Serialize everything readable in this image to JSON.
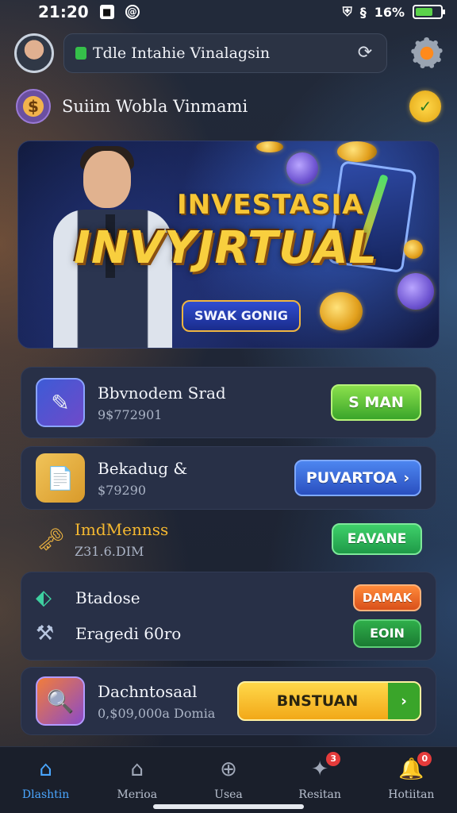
{
  "status_bar": {
    "time": "21:20",
    "battery": "16%"
  },
  "header": {
    "search_text": "Tdle Intahie Vinalagsin"
  },
  "welcome": {
    "text": "Suiim Wobla Vinmami"
  },
  "banner": {
    "title_line1": "INVESTASIA",
    "title_line2": "INVYJRTUAL",
    "button_label": "SWAK GONIG"
  },
  "cards": [
    {
      "title": "Bbvnodem Srad",
      "subtitle": "9$772901",
      "button": "S MAN"
    },
    {
      "title": "Bekadug &",
      "subtitle": "$79290",
      "button": "PUVARTOA"
    },
    {
      "title": "ImdMennss",
      "subtitle": "Z31.6.DIM",
      "button": "EAVANE"
    },
    {
      "title": "Btadose",
      "button": "DAMAK"
    },
    {
      "title": "Eragedi 60ro",
      "button": "EOIN"
    },
    {
      "title": "Dachntosaal",
      "subtitle": "0,$09,000a Domia",
      "button": "BNSTUAN"
    }
  ],
  "nav": [
    {
      "label": "Dlashtin",
      "active": true
    },
    {
      "label": "Merioa",
      "active": false
    },
    {
      "label": "Usea",
      "active": false
    },
    {
      "label": "Resitan",
      "badge": "3",
      "active": false
    },
    {
      "label": "Hotiitan",
      "badge": "0",
      "active": false
    }
  ],
  "colors": {
    "accent_blue": "#4aa6ff",
    "accent_gold": "#f8cf3e",
    "card_bg": "#283047"
  }
}
